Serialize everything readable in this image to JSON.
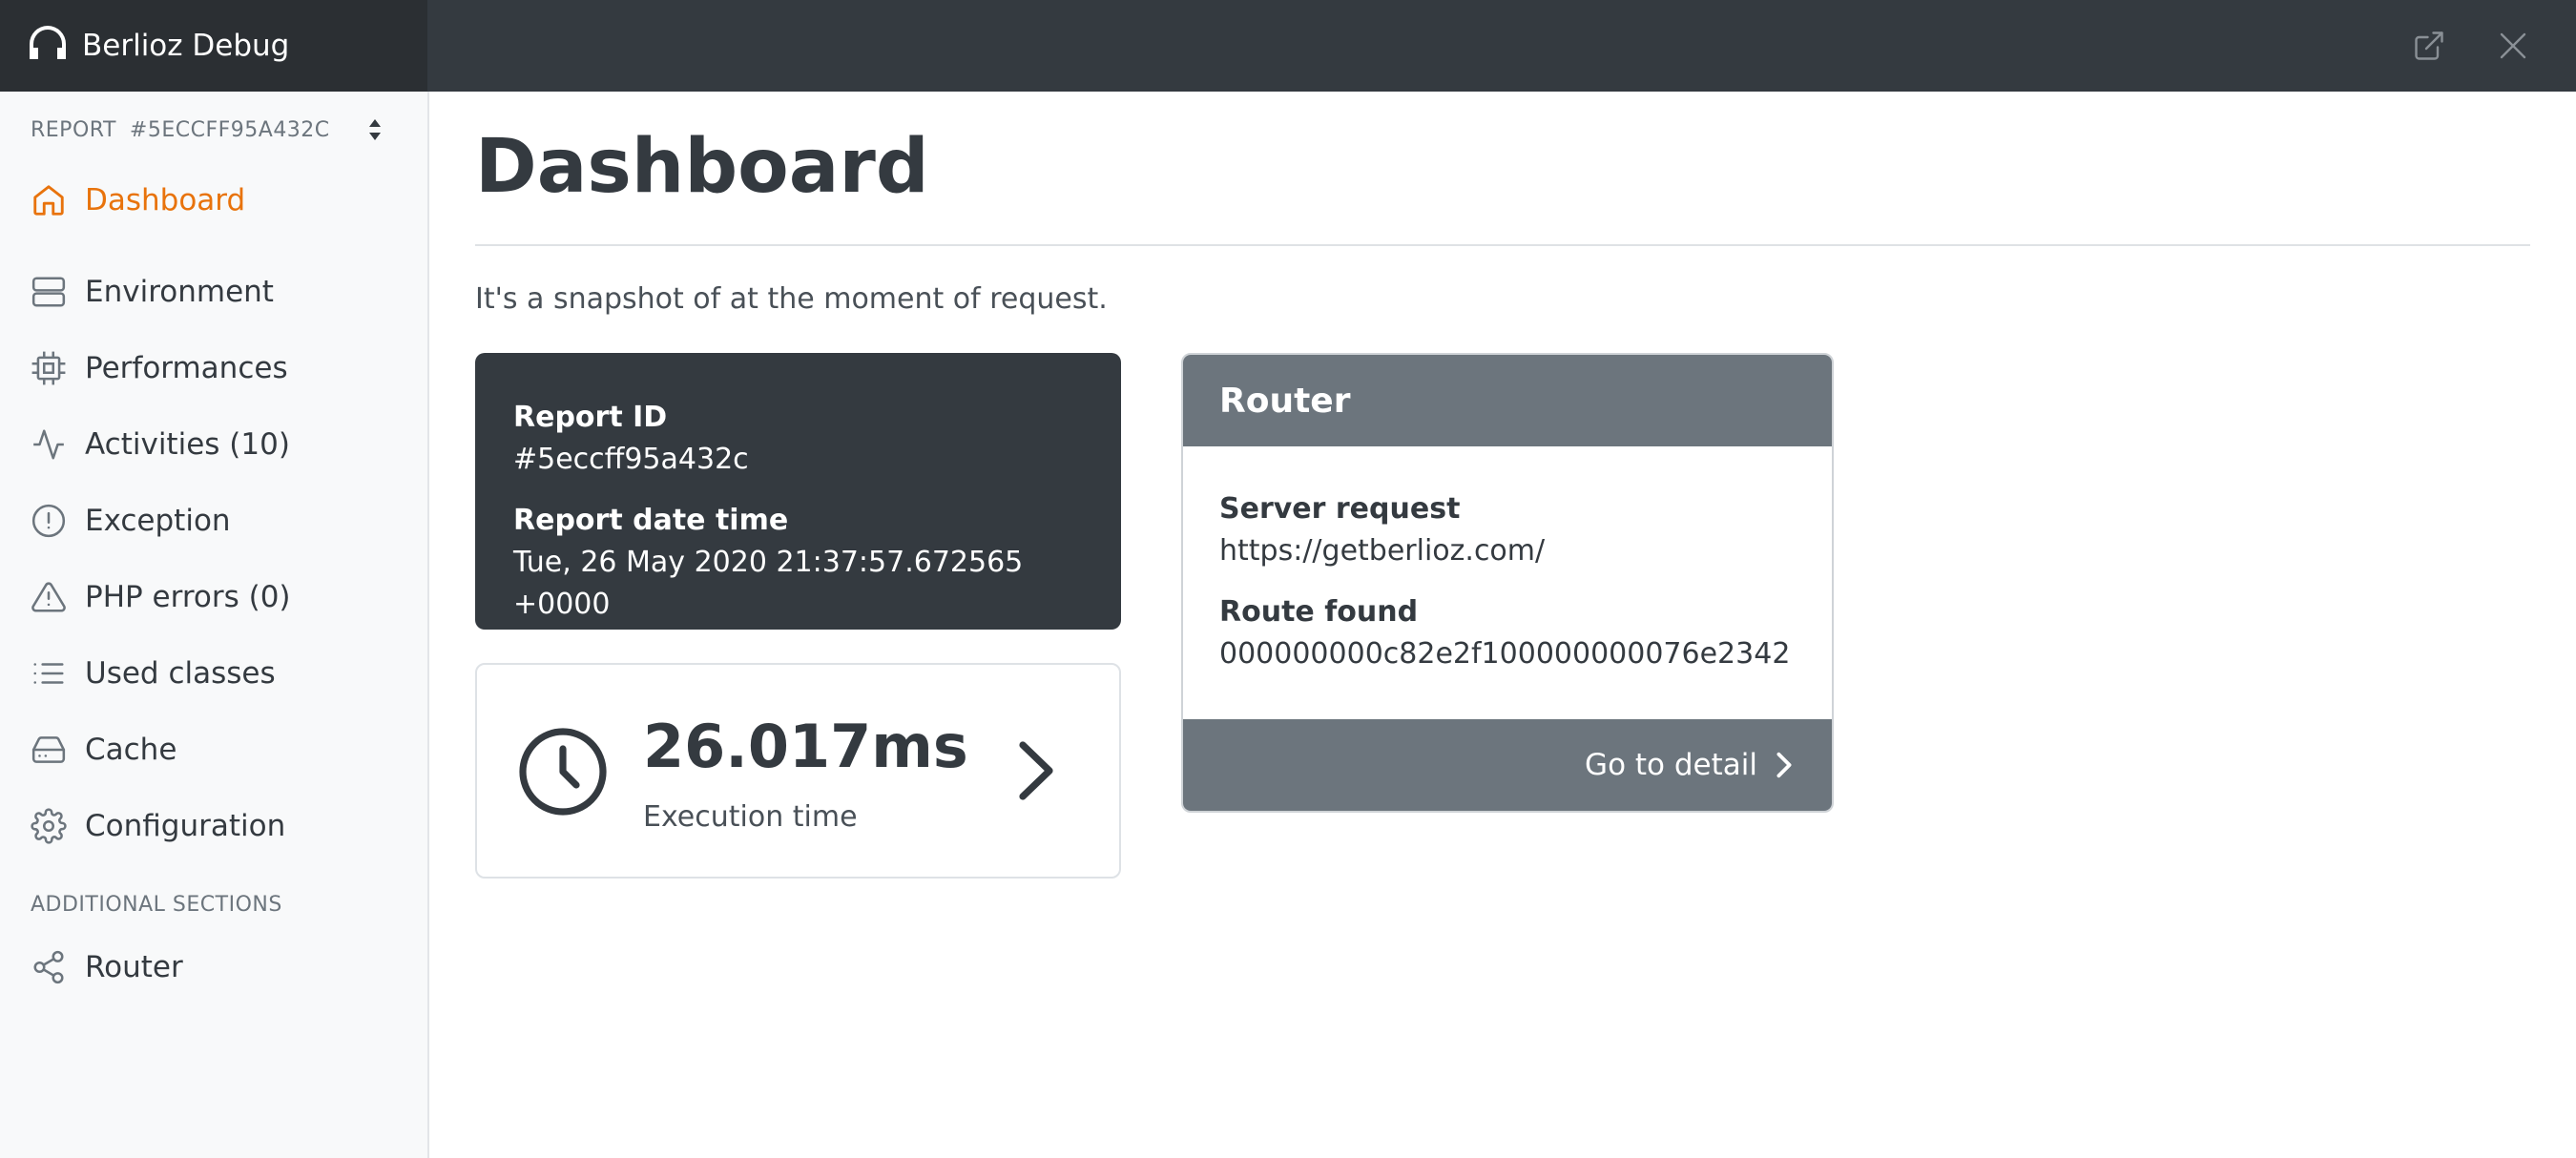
{
  "app": {
    "title": "Berlioz Debug"
  },
  "colors": {
    "accent": "#e8730c",
    "dark": "#343a40",
    "secondary": "#6c757d"
  },
  "report_selector": {
    "label": "REPORT",
    "id": "#5ECCFF95A432C"
  },
  "sidebar": {
    "items": [
      {
        "label": "Dashboard",
        "icon": "home-icon",
        "active": true
      },
      {
        "label": "Environment",
        "icon": "server-icon"
      },
      {
        "label": "Performances",
        "icon": "cpu-icon"
      },
      {
        "label": "Activities (10)",
        "icon": "activity-icon"
      },
      {
        "label": "Exception",
        "icon": "alert-circle-icon"
      },
      {
        "label": "PHP errors (0)",
        "icon": "alert-triangle-icon"
      },
      {
        "label": "Used classes",
        "icon": "list-icon"
      },
      {
        "label": "Cache",
        "icon": "hard-drive-icon"
      },
      {
        "label": "Configuration",
        "icon": "settings-icon"
      }
    ],
    "additional_title": "ADDITIONAL SECTIONS",
    "additional_items": [
      {
        "label": "Router",
        "icon": "share-icon"
      }
    ]
  },
  "main": {
    "title": "Dashboard",
    "lead": "It's a snapshot of at the moment of request.",
    "report_card": {
      "id_label": "Report ID",
      "id_value": "#5eccff95a432c",
      "date_label": "Report date time",
      "date_value": "Tue, 26 May 2020 21:37:57.672565 +0000"
    },
    "execution_card": {
      "value": "26.017ms",
      "label": "Execution time"
    },
    "router_card": {
      "title": "Router",
      "request_label": "Server request",
      "request_value": "https://getberlioz.com/",
      "route_label": "Route found",
      "route_value": "000000000c82e2f100000000076e2342",
      "detail_link": "Go to detail"
    }
  }
}
